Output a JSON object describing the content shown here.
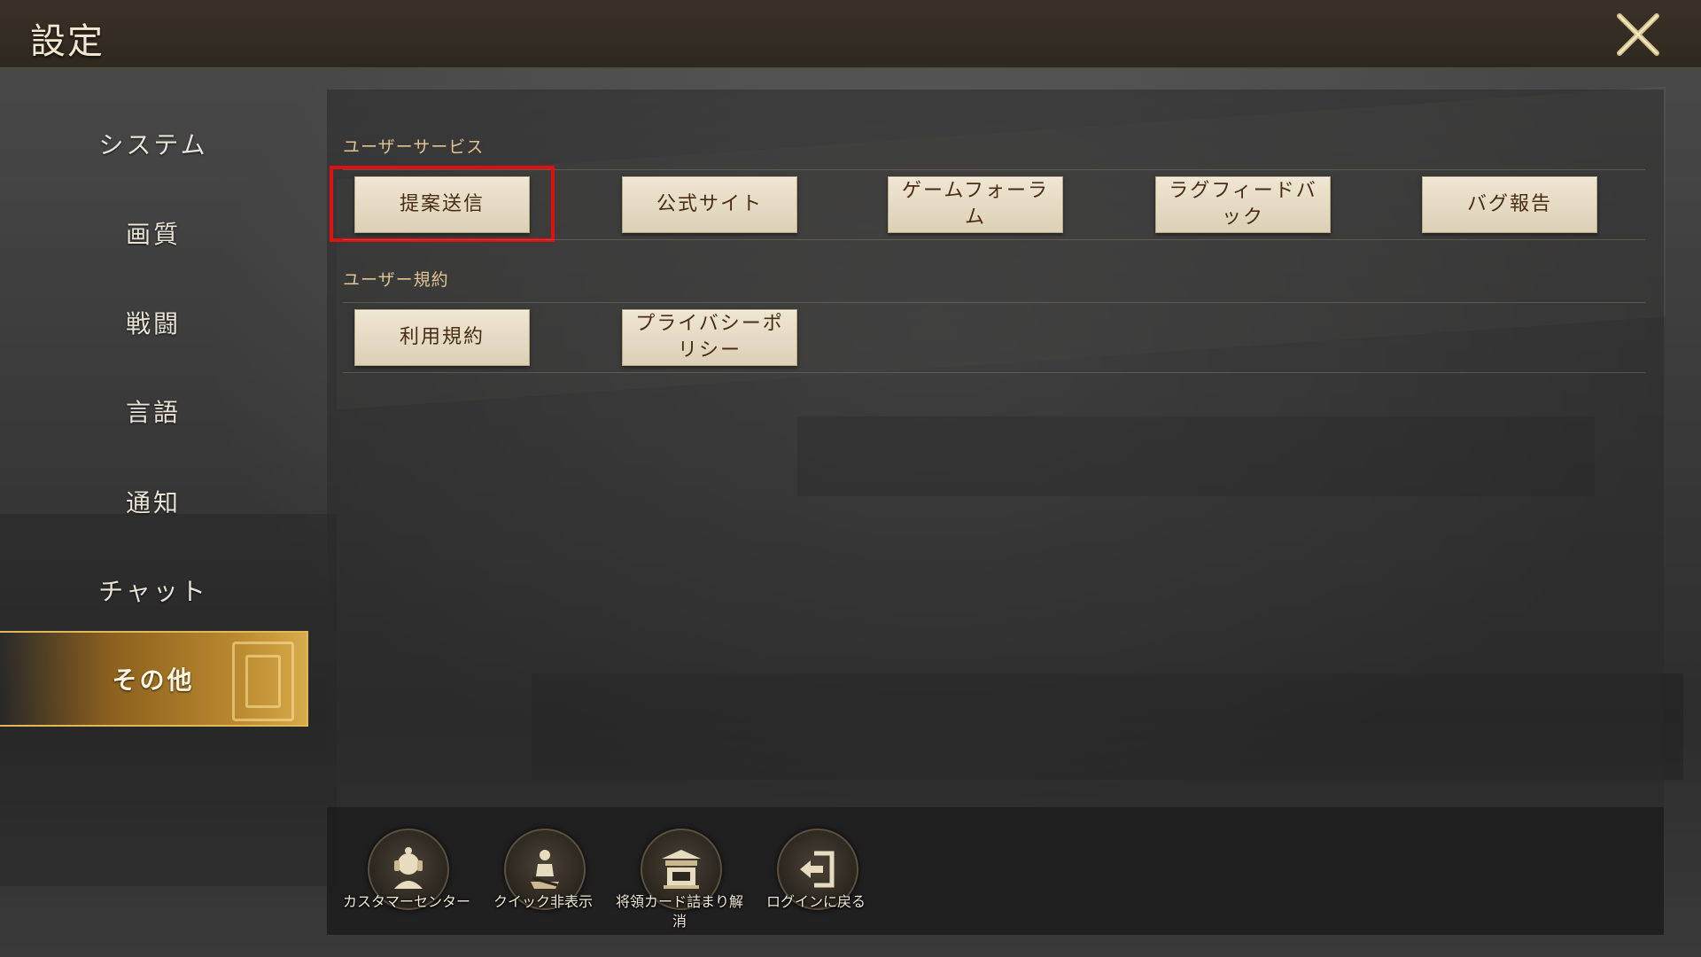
{
  "header": {
    "title": "設定",
    "close_icon": "close-crossed-swords-icon"
  },
  "sidebar": {
    "items": [
      {
        "label": "システム",
        "active": false
      },
      {
        "label": "画質",
        "active": false
      },
      {
        "label": "戦闘",
        "active": false
      },
      {
        "label": "言語",
        "active": false
      },
      {
        "label": "通知",
        "active": false
      },
      {
        "label": "チャット",
        "active": false
      },
      {
        "label": "その他",
        "active": true
      }
    ]
  },
  "main": {
    "user_service": {
      "label": "ユーザーサービス",
      "buttons": [
        "提案送信",
        "公式サイト",
        "ゲームフォーラム",
        "ラグフィードバック",
        "バグ報告"
      ]
    },
    "user_terms": {
      "label": "ユーザー規約",
      "buttons": [
        "利用規約",
        "プライバシーポリシー"
      ]
    }
  },
  "bottom_bar": {
    "items": [
      {
        "label": "カスタマーセンター",
        "icon": "customer-center-icon"
      },
      {
        "label": "クイック非表示",
        "icon": "quick-hide-icon"
      },
      {
        "label": "将領カード詰まり解消",
        "icon": "general-card-unstuck-icon"
      },
      {
        "label": "ログインに戻る",
        "icon": "return-to-login-icon"
      }
    ]
  },
  "colors": {
    "accent_gold": "#d7aa4a",
    "button_bg": "#e6dcc4",
    "button_text": "#4a2c14",
    "section_label": "#e0c592",
    "highlight": "#e01010"
  }
}
